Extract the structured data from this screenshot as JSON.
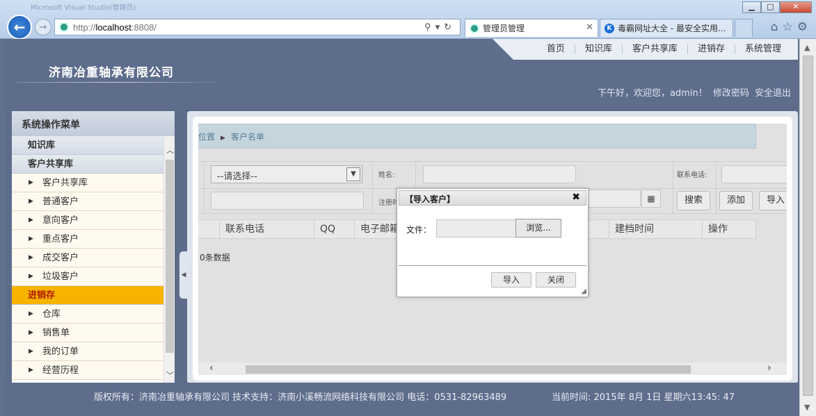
{
  "browser": {
    "window_title": "Microsoft Visual Studio(管理员)",
    "address": {
      "prefix": "http://",
      "host": "localhost",
      "port": ":8808/"
    },
    "tabs": [
      {
        "label": "管理员管理",
        "active": true
      },
      {
        "label": "毒霸网址大全 - 最安全实用..."
      }
    ],
    "tab2_favicon_letter": "K",
    "window_controls": {
      "minimize": "▁",
      "maximize": "□",
      "close": "✕"
    }
  },
  "header": {
    "company": "济南冶重轴承有限公司",
    "nav": [
      "首页",
      "知识库",
      "客户共享库",
      "进销存",
      "系统管理"
    ],
    "greeting": "下午好，欢迎您，admin！",
    "change_password": "修改密码",
    "logout": "安全退出"
  },
  "sidebar": {
    "title": "系统操作菜单",
    "groups": [
      {
        "label": "知识库",
        "items": []
      },
      {
        "label": "客户共享库",
        "items": [
          "客户共享库",
          "普通客户",
          "意向客户",
          "重点客户",
          "成交客户",
          "垃圾客户"
        ]
      },
      {
        "label": "进销存",
        "active": true,
        "items": [
          "仓库",
          "销售单",
          "我的订单",
          "经营历程"
        ]
      }
    ]
  },
  "main": {
    "breadcrumb": {
      "prefix": "位置",
      "current": "客户名单"
    },
    "filter": {
      "category_placeholder": "--请选择--",
      "name_label": "姓名:",
      "phone_label": "联系电话:",
      "register_label": "注册时"
    },
    "actions": {
      "search": "搜索",
      "add": "添加",
      "import": "导入"
    },
    "columns": [
      "联系电话",
      "QQ",
      "电子邮箱",
      "建档时间",
      "操作"
    ],
    "empty_text": "0条数据"
  },
  "modal": {
    "title": "【导入客户】",
    "file_label": "文件：",
    "browse": "浏览...",
    "import": "导入",
    "close": "关闭"
  },
  "footer": {
    "copyright": "版权所有：济南冶重轴承有限公司 技术支持：济南小溪畅流网络科技有限公司 电话：0531-82963489",
    "clock": "当前时间: 2015年 8月 1日   星期六13:45: 47"
  },
  "colors": {
    "header_bg": "#5e6d8c",
    "active_group": "#f6b400",
    "active_group_text": "#b01c00",
    "breadcrumb_bg": "#c5d5de"
  },
  "icons": [
    "back-arrow-icon",
    "forward-arrow-icon",
    "search-icon",
    "refresh-icon",
    "home-icon",
    "star-icon",
    "gear-icon",
    "calendar-icon",
    "close-icon"
  ]
}
